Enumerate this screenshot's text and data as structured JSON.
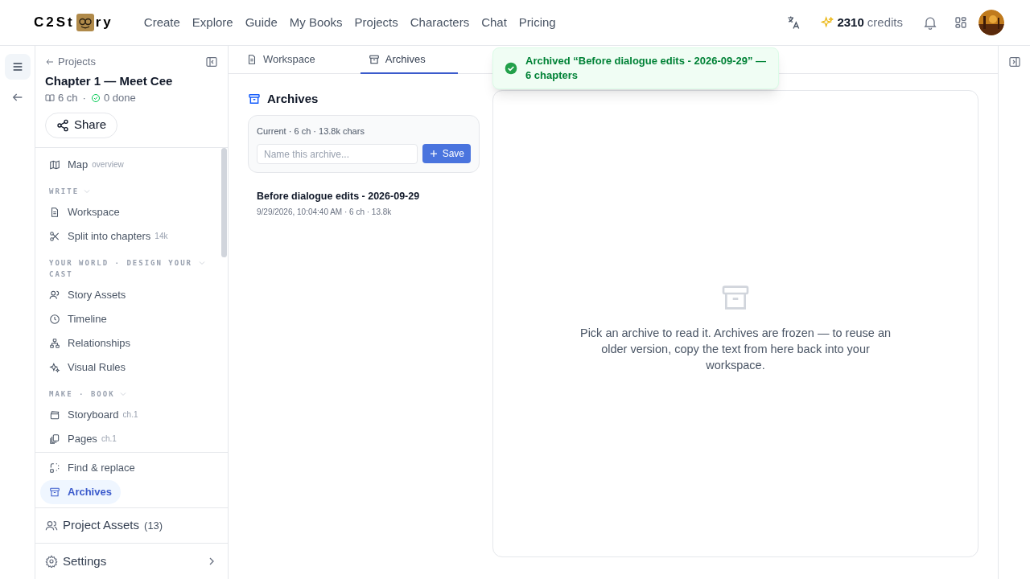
{
  "header": {
    "logo": {
      "before": "C2St",
      "after": "ry"
    },
    "nav": [
      "Create",
      "Explore",
      "Guide",
      "My Books",
      "Projects",
      "Characters",
      "Chat",
      "Pricing"
    ],
    "credits": {
      "amount": "2310",
      "label": "credits"
    }
  },
  "toast": {
    "message": "Archived “Before dialogue edits - 2026-09-29” — 6 chapters"
  },
  "sidebar": {
    "back_link": "Projects",
    "title": "Chapter 1 — Meet Cee",
    "chapters": "6 ch",
    "separator": "·",
    "done": "0 done",
    "share_button": "Share",
    "nav": [
      {
        "kind": "item",
        "label": "Map",
        "hint": "overview",
        "selected": false
      },
      {
        "kind": "header",
        "label": "WRITE"
      },
      {
        "kind": "item",
        "label": "Workspace",
        "selected": false
      },
      {
        "kind": "item",
        "label": "Split into chapters",
        "hint": "14k",
        "selected": false
      },
      {
        "kind": "header",
        "label": "YOUR WORLD · DESIGN YOUR CAST"
      },
      {
        "kind": "item",
        "label": "Story Assets",
        "selected": false
      },
      {
        "kind": "item",
        "label": "Timeline",
        "selected": false
      },
      {
        "kind": "item",
        "label": "Relationships",
        "selected": false
      },
      {
        "kind": "item",
        "label": "Visual Rules",
        "selected": false
      },
      {
        "kind": "header",
        "label": "MAKE · BOOK"
      },
      {
        "kind": "item",
        "label": "Storyboard",
        "hint": "ch.1",
        "selected": false
      },
      {
        "kind": "item",
        "label": "Pages",
        "hint": "ch.1",
        "selected": false
      }
    ],
    "tools": [
      {
        "label": "Find & replace",
        "selected": false
      },
      {
        "label": "Archives",
        "selected": true
      }
    ],
    "project_assets": {
      "label": "Project Assets",
      "count": "(13)"
    },
    "settings": "Settings"
  },
  "tabs": [
    {
      "label": "Workspace",
      "selected": false
    },
    {
      "label": "Archives",
      "selected": true
    }
  ],
  "archives": {
    "title": "Archives",
    "current": "Current · 6 ch · 13.8k chars",
    "name_field": {
      "placeholder": "Name this archive..."
    },
    "save_button": "Save",
    "items": [
      {
        "name": "Before dialogue edits - 2026-09-29",
        "meta": "9/29/2026, 10:04:40 AM · 6 ch · 13.8k"
      }
    ]
  },
  "empty_state": {
    "message": "Pick an archive to read it. Archives are frozen — to reuse an older version, copy the text from here back into your workspace."
  }
}
